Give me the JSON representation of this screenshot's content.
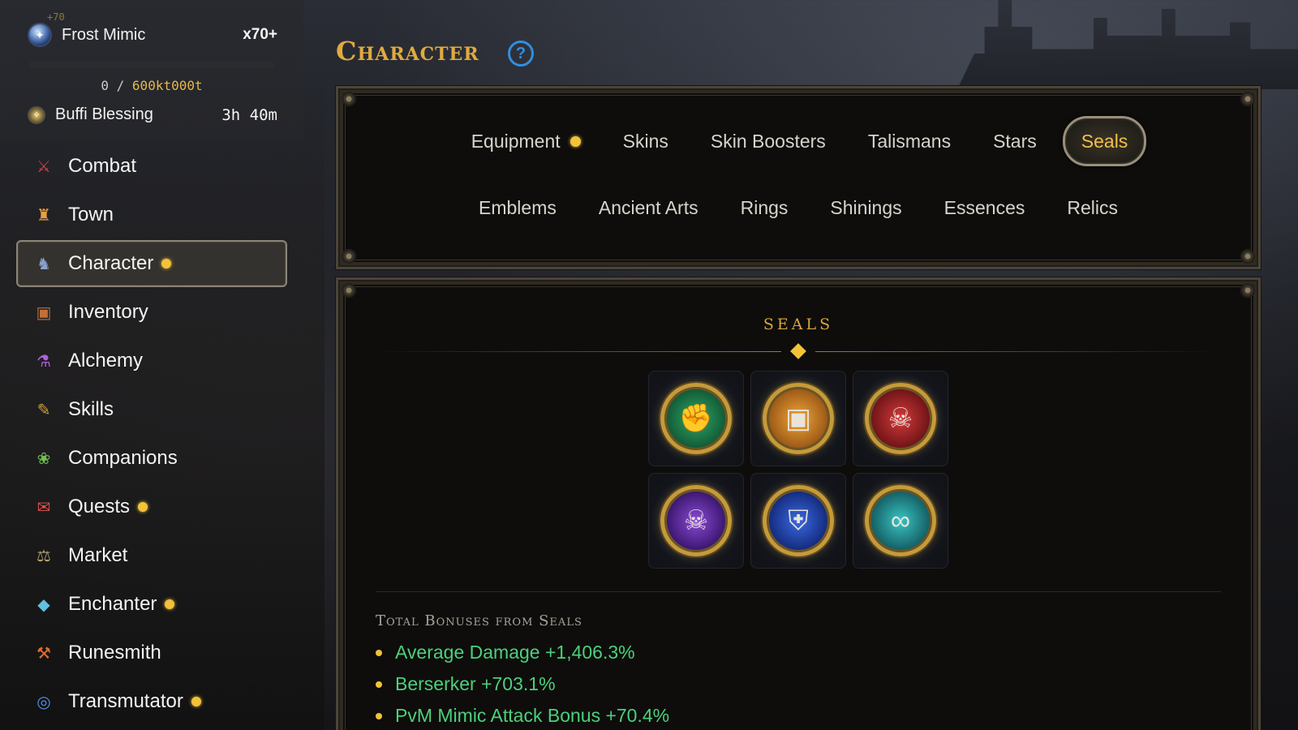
{
  "status": {
    "small_label": "+70",
    "buff1": {
      "name": "Frost Mimic",
      "value": "x70+"
    },
    "xp": {
      "current": "0",
      "sep": " / ",
      "max": "600kt000t",
      "progress": 0
    },
    "buff2": {
      "name": "Buffi Blessing",
      "value": "3h 40m"
    }
  },
  "nav": [
    {
      "label": "Combat",
      "icon": "crossed-swords-icon",
      "glyph": "⚔",
      "color": "#d04040",
      "dot": false,
      "active": false
    },
    {
      "label": "Town",
      "icon": "castle-icon",
      "glyph": "♜",
      "color": "#e8a040",
      "dot": false,
      "active": false
    },
    {
      "label": "Character",
      "icon": "knight-icon",
      "glyph": "♞",
      "color": "#8aa0d0",
      "dot": true,
      "active": true
    },
    {
      "label": "Inventory",
      "icon": "backpack-icon",
      "glyph": "▣",
      "color": "#c0703a",
      "dot": false,
      "active": false
    },
    {
      "label": "Alchemy",
      "icon": "potion-icon",
      "glyph": "⚗",
      "color": "#b060e0",
      "dot": false,
      "active": false
    },
    {
      "label": "Skills",
      "icon": "book-icon",
      "glyph": "✎",
      "color": "#d0a040",
      "dot": false,
      "active": false
    },
    {
      "label": "Companions",
      "icon": "paw-icon",
      "glyph": "❀",
      "color": "#70c050",
      "dot": false,
      "active": false
    },
    {
      "label": "Quests",
      "icon": "scroll-icon",
      "glyph": "✉",
      "color": "#e05050",
      "dot": true,
      "active": false
    },
    {
      "label": "Market",
      "icon": "scales-icon",
      "glyph": "⚖",
      "color": "#b0a070",
      "dot": false,
      "active": false
    },
    {
      "label": "Enchanter",
      "icon": "crystal-icon",
      "glyph": "◆",
      "color": "#60c0e0",
      "dot": true,
      "active": false
    },
    {
      "label": "Runesmith",
      "icon": "hammer-icon",
      "glyph": "⚒",
      "color": "#e07030",
      "dot": false,
      "active": false
    },
    {
      "label": "Transmutator",
      "icon": "swirl-orb-icon",
      "glyph": "◎",
      "color": "#5090f0",
      "dot": true,
      "active": false
    }
  ],
  "page": {
    "title": "Character",
    "help": "?"
  },
  "tabs": {
    "row1": [
      {
        "label": "Equipment",
        "dot": true,
        "active": false
      },
      {
        "label": "Skins",
        "dot": false,
        "active": false
      },
      {
        "label": "Skin Boosters",
        "dot": false,
        "active": false
      },
      {
        "label": "Talismans",
        "dot": false,
        "active": false
      },
      {
        "label": "Stars",
        "dot": false,
        "active": false
      },
      {
        "label": "Seals",
        "dot": false,
        "active": true
      }
    ],
    "row2": [
      {
        "label": "Emblems"
      },
      {
        "label": "Ancient Arts"
      },
      {
        "label": "Rings"
      },
      {
        "label": "Shinings"
      },
      {
        "label": "Essences"
      },
      {
        "label": "Relics"
      }
    ]
  },
  "seals": {
    "title": "SEALS",
    "items": [
      {
        "icon": "fist-seal-icon",
        "glyph": "✊",
        "color": "green"
      },
      {
        "icon": "mimic-chest-seal-icon",
        "glyph": "▣",
        "color": "orange"
      },
      {
        "icon": "skull-trident-seal-icon",
        "glyph": "☠",
        "color": "red"
      },
      {
        "icon": "purple-skull-seal-icon",
        "glyph": "☠",
        "color": "purple"
      },
      {
        "icon": "spartan-shield-seal-icon",
        "glyph": "⛨",
        "color": "blue"
      },
      {
        "icon": "infinity-seal-icon",
        "glyph": "∞",
        "color": "teal"
      }
    ],
    "bonus_title": "Total Bonuses from Seals",
    "bonuses": [
      "Average Damage +1,406.3%",
      "Berserker +703.1%",
      "PvM Mimic Attack Bonus +70.4%"
    ]
  }
}
